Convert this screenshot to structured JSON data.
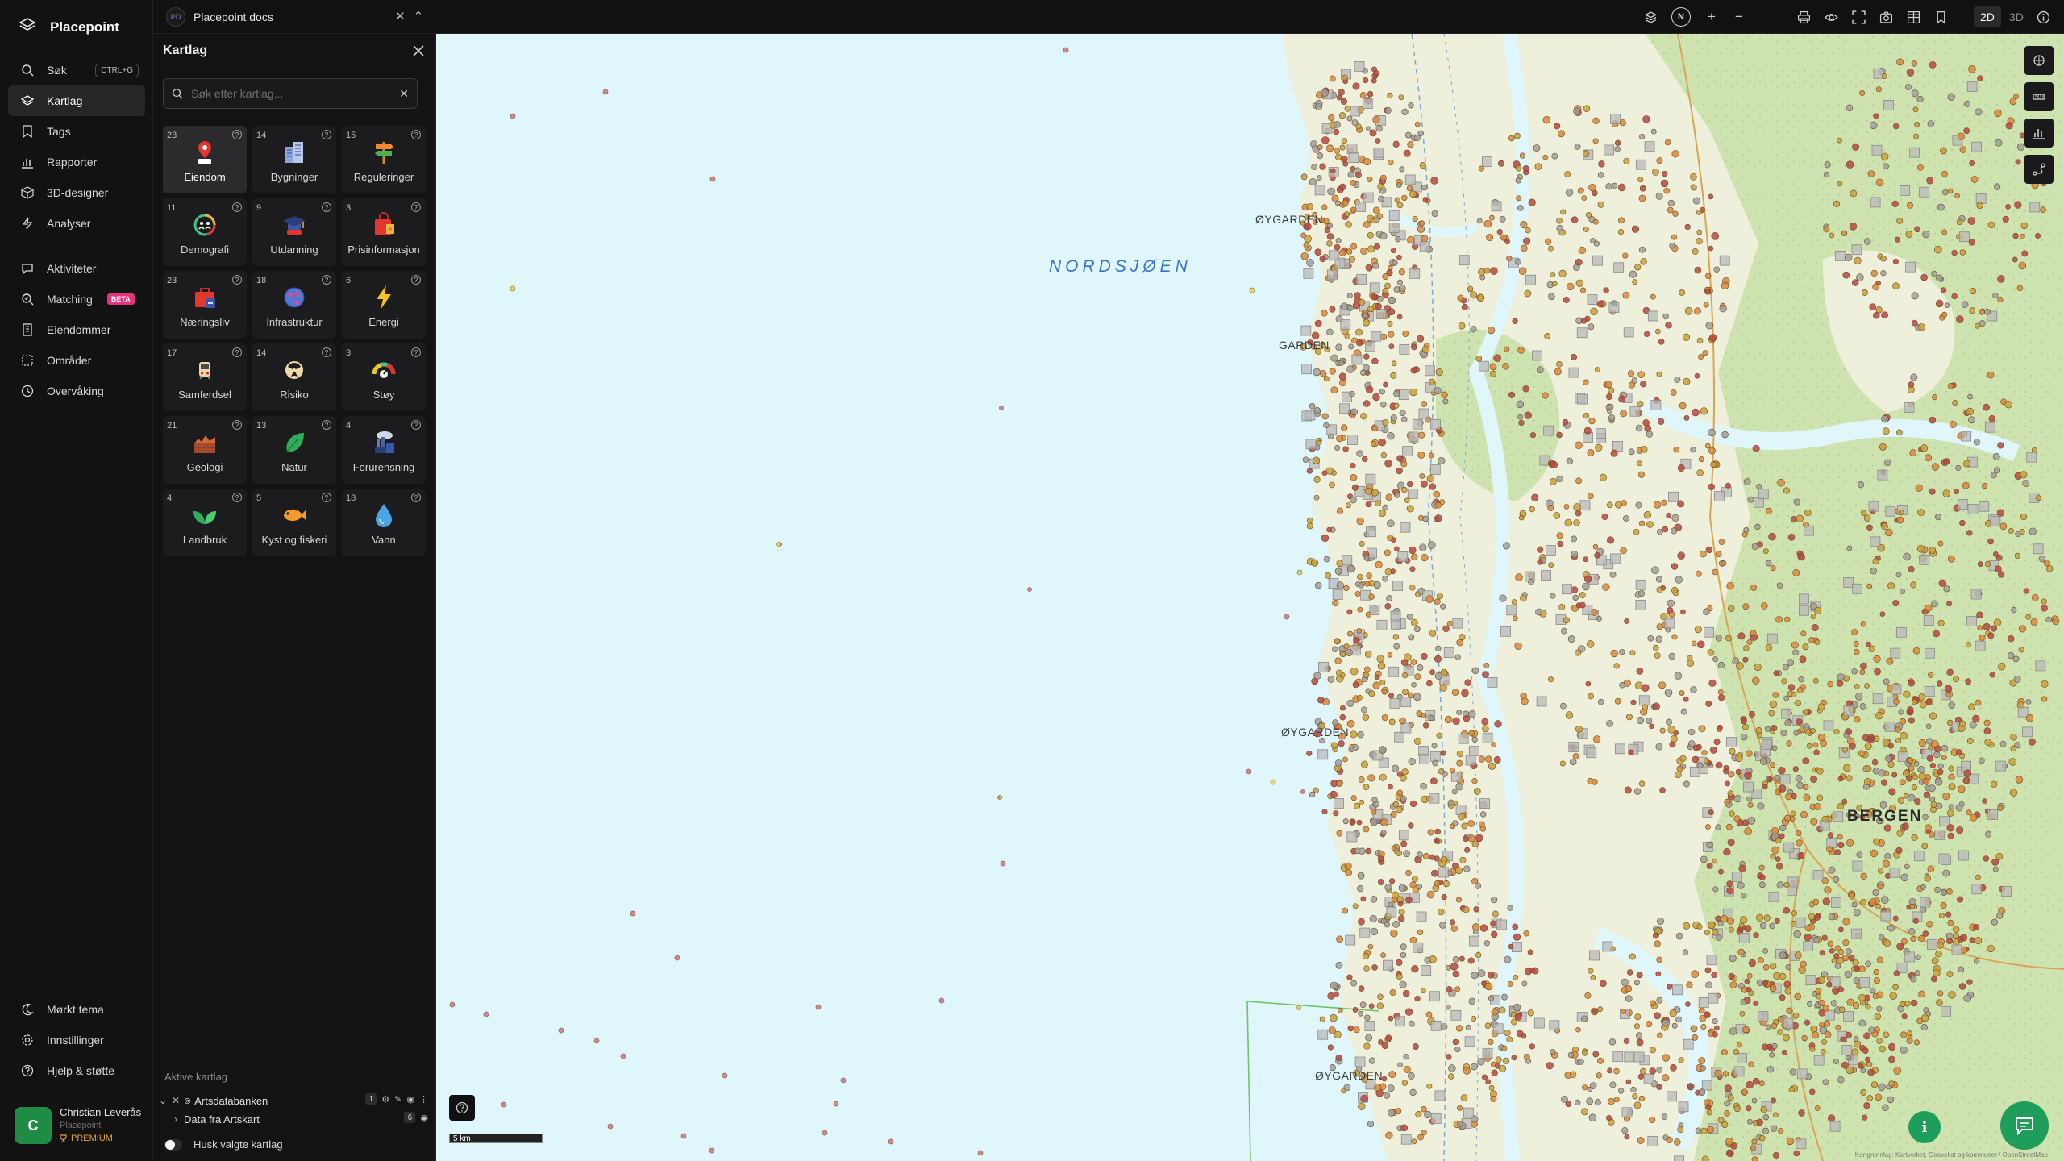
{
  "app": {
    "name": "Placepoint"
  },
  "workspace": {
    "badge": "PD",
    "name": "Placepoint docs"
  },
  "nav": {
    "items": [
      {
        "label": "Søk",
        "icon": "search-icon",
        "shortcut": "CTRL+G"
      },
      {
        "label": "Kartlag",
        "icon": "layers-icon",
        "active": true
      },
      {
        "label": "Tags",
        "icon": "bookmark-icon"
      },
      {
        "label": "Rapporter",
        "icon": "bar-chart-icon"
      },
      {
        "label": "3D-designer",
        "icon": "cube-icon"
      },
      {
        "label": "Analyser",
        "icon": "bolt-icon"
      }
    ],
    "items2": [
      {
        "label": "Aktiviteter",
        "icon": "chat-icon"
      },
      {
        "label": "Matching",
        "icon": "search-check-icon",
        "badge": "BETA"
      },
      {
        "label": "Eiendommer",
        "icon": "building-icon"
      },
      {
        "label": "Områder",
        "icon": "area-icon"
      },
      {
        "label": "Overvåking",
        "icon": "clock-icon"
      }
    ],
    "bottom": [
      {
        "label": "Mørkt tema",
        "icon": "moon-icon"
      },
      {
        "label": "Innstillinger",
        "icon": "gear-icon"
      },
      {
        "label": "Hjelp & støtte",
        "icon": "help-icon"
      }
    ]
  },
  "user": {
    "initial": "C",
    "name": "Christian Leverås",
    "org": "Placepoint",
    "tier": "PREMIUM"
  },
  "panel": {
    "title": "Kartlag",
    "search_placeholder": "Søk etter kartlag...",
    "categories": [
      {
        "count": "23",
        "label": "Eiendom",
        "icon": "property-pin-icon",
        "active": true
      },
      {
        "count": "14",
        "label": "Bygninger",
        "icon": "buildings-icon"
      },
      {
        "count": "15",
        "label": "Reguleringer",
        "icon": "signpost-icon"
      },
      {
        "count": "11",
        "label": "Demografi",
        "icon": "demography-icon"
      },
      {
        "count": "9",
        "label": "Utdanning",
        "icon": "graduation-cap-icon"
      },
      {
        "count": "3",
        "label": "Prisinformasjon",
        "icon": "price-bag-icon"
      },
      {
        "count": "23",
        "label": "Næringsliv",
        "icon": "business-bag-icon"
      },
      {
        "count": "18",
        "label": "Infrastruktur",
        "icon": "globe-icon"
      },
      {
        "count": "6",
        "label": "Energi",
        "icon": "lightning-icon"
      },
      {
        "count": "17",
        "label": "Samferdsel",
        "icon": "train-icon"
      },
      {
        "count": "14",
        "label": "Risiko",
        "icon": "hazard-icon"
      },
      {
        "count": "3",
        "label": "Støy",
        "icon": "noise-gauge-icon"
      },
      {
        "count": "21",
        "label": "Geologi",
        "icon": "terrain-icon"
      },
      {
        "count": "13",
        "label": "Natur",
        "icon": "leaf-icon"
      },
      {
        "count": "4",
        "label": "Forurensning",
        "icon": "factory-icon"
      },
      {
        "count": "4",
        "label": "Landbruk",
        "icon": "sprout-icon"
      },
      {
        "count": "5",
        "label": "Kyst og fiskeri",
        "icon": "fish-icon"
      },
      {
        "count": "18",
        "label": "Vann",
        "icon": "water-drop-icon"
      }
    ],
    "active_title": "Aktive kartlag",
    "active_layers": [
      {
        "name": "Artsdatabanken",
        "count": "1"
      },
      {
        "name": "Data fra Artskart",
        "count": "6"
      }
    ],
    "remember_label": "Husk valgte kartlag"
  },
  "toolbar": {
    "north_label": "N",
    "view_2d": "2D",
    "view_3d": "3D",
    "active_view": "2D"
  },
  "map": {
    "sea_label": "NORDSJØEN",
    "city_label": "BERGEN",
    "place_labels": [
      {
        "text": "ØYGARDEN"
      },
      {
        "text": "GARDEN"
      },
      {
        "text": "ØYGARDEN"
      },
      {
        "text": "ØYGARDEN"
      }
    ],
    "scale_label": "5 km",
    "attribution": "Kartgrunnlag: Kartverket, Geovekst og kommuner / OpenStreetMap"
  },
  "colors": {
    "sea": "#dff7fb",
    "land": "#eef0dc",
    "forest": "#cfe6b6",
    "point_orange": "#d98a3a",
    "point_red": "#b8463f",
    "accent_green": "#1f9d5a"
  }
}
